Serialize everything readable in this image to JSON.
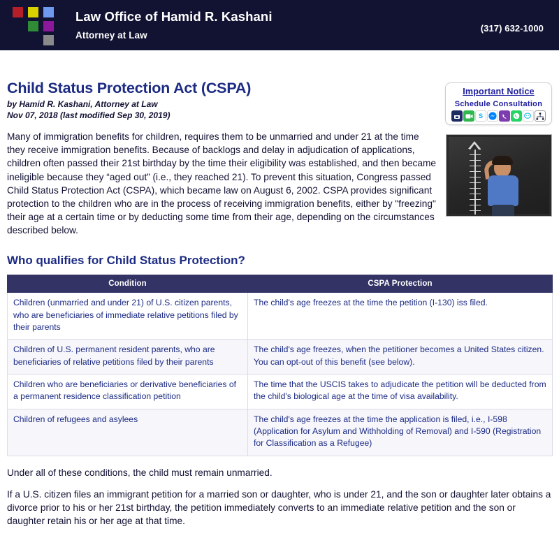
{
  "header": {
    "brand_name": "Law Office of Hamid R. Kashani",
    "brand_sub": "Attorney at Law",
    "phone": "(317) 632-1000",
    "logo_colors": [
      "#b51f2a",
      "#d9d100",
      "#6e9bf0",
      "#2f8b36",
      "#8d189b",
      "#8a8a8a"
    ],
    "bar_color": "#121233"
  },
  "notice": {
    "title": "Important Notice",
    "subtitle": "Schedule Consultation",
    "icons": [
      {
        "name": "calendar-icon",
        "glyph": "☎"
      },
      {
        "name": "video-camera-icon",
        "glyph": "▶"
      },
      {
        "name": "skype-icon",
        "glyph": "S"
      },
      {
        "name": "messenger-icon",
        "glyph": "⚡"
      },
      {
        "name": "viber-icon",
        "glyph": "✆"
      },
      {
        "name": "whatsapp-icon",
        "glyph": "✆"
      },
      {
        "name": "wechat-icon",
        "glyph": "●"
      },
      {
        "name": "sitemap-icon",
        "glyph": "ᛩ"
      }
    ]
  },
  "article": {
    "title": "Child Status Protection Act (CSPA)",
    "byline": "by Hamid R. Kashani, Attorney at Law",
    "dateline": "Nov 07, 2018 (last modified Sep 30, 2019)",
    "intro_paragraph": "Many of immigration benefits for children, requires them to be unmarried and under 21 at the time they receive immigration benefits. Because of backlogs and delay in adjudication of applications, children often passed their 21st birthday by the time their eligibility was established, and then became ineligible because they “aged out” (i.e., they reached 21). To prevent this situation, Congress passed Child Status Protection Act (CSPA), which became law on August 6, 2002.  CSPA provides significant protection to the children who are in the process of receiving immigration benefits, either by \"freezing\" their age at a certain time or by deducting some time from their age, depending on the circumstances described below.",
    "image_alt": "Boy measuring his height against a chalkboard height chart"
  },
  "section": {
    "heading": "Who qualifies for Child Status Protection?"
  },
  "table": {
    "columns": [
      "Condition",
      "CSPA Protection"
    ],
    "rows": [
      {
        "condition": "Children (unmarried and under 21) of U.S. citizen parents, who are beneficiaries of immediate relative petitions filed by their parents",
        "protection": "The child's age freezes at the time the petition (I-130) iss filed."
      },
      {
        "condition": "Children of U.S. permanent resident parents, who are beneficiaries of relative petitions filed by their parents",
        "protection": "The child's age freezes, when the petitioner becomes a United States citizen. You can opt-out of this benefit (see below)."
      },
      {
        "condition": "Children who are beneficiaries or derivative beneficiaries of a permanent residence classification petition",
        "protection": "The time that the USCIS takes to adjudicate the petition will be deducted from the child's biological age at the time of visa availability."
      },
      {
        "condition": "Children of refugees and asylees",
        "protection": "The child's age freezes at the time the application is filed, i.e., I-598 (Application for Asylum and Withholding of Removal) and I-590 (Registration for Classification as a Refugee)"
      }
    ],
    "header_bg": "#333366",
    "alt_row_bg": "#f6f6fb"
  },
  "footer_paragraphs": {
    "p1": "Under all of these conditions, the child must remain unmarried.",
    "p2": "If a U.S. citizen files an immigrant petition for a married son or daughter, who is under 21, and the son or daughter later obtains a divorce prior to his or her 21st birthday, the petition immediately converts to an immediate relative petition and the son or daughter retain his or her age at that time."
  }
}
